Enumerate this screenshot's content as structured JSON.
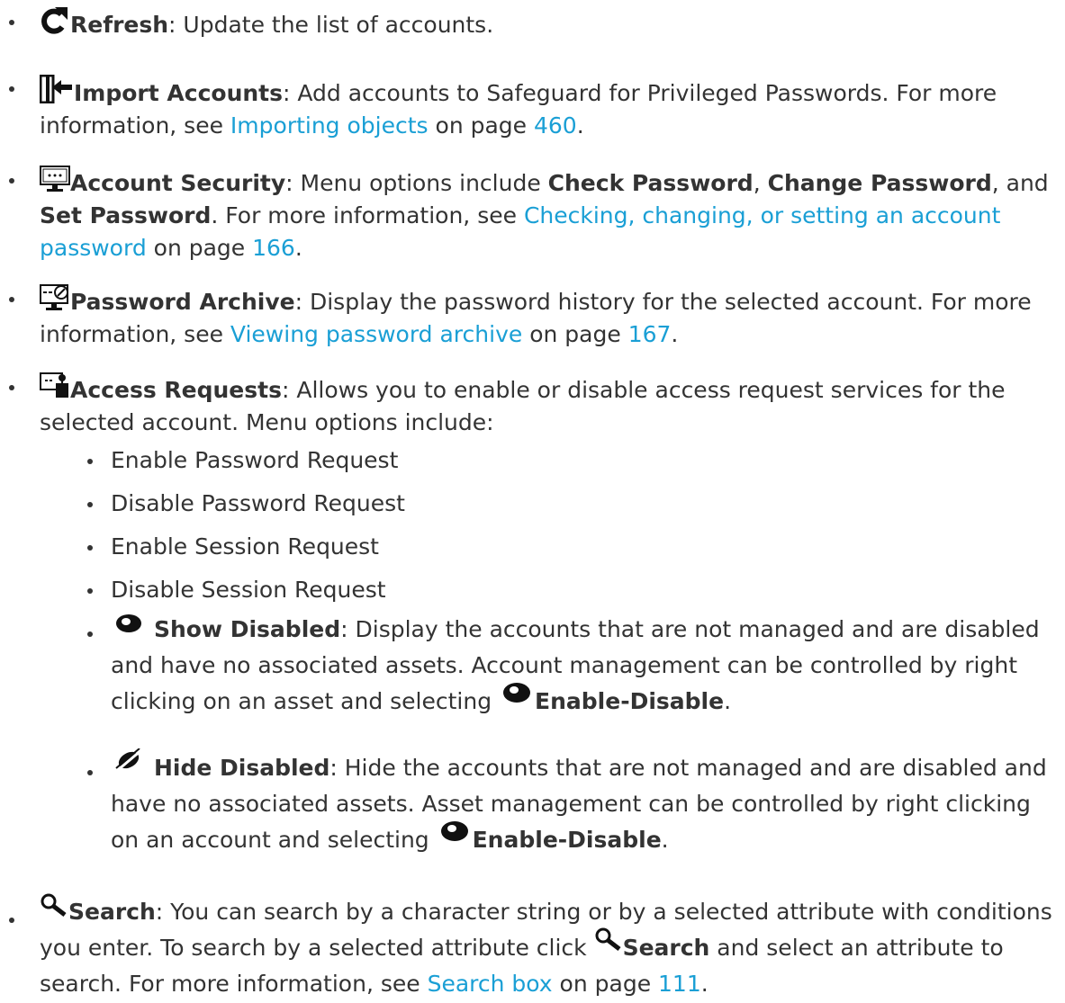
{
  "items": [
    {
      "icon": "refresh-icon",
      "title": "Refresh",
      "text": ": Update the list of accounts."
    },
    {
      "icon": "import-icon",
      "title": "Import Accounts",
      "text": ": Add accounts to Safeguard for Privileged Passwords. For more information, see ",
      "link": "Importing objects",
      "after": " on page ",
      "page": "460",
      "end": "."
    },
    {
      "icon": "account-security-icon",
      "title": "Account Security",
      "text1": ": Menu options include ",
      "opt1": "Check Password",
      "sep1": ", ",
      "opt2": "Change Password",
      "sep2": ", and ",
      "opt3": "Set Password",
      "text2": ". For more information, see ",
      "link": "Checking, changing, or setting an account password",
      "after": " on page ",
      "page": "166",
      "end": "."
    },
    {
      "icon": "password-archive-icon",
      "title": "Password Archive",
      "text": ": Display the password history for the selected account. For more information, see ",
      "link": "Viewing password archive",
      "after": " on page ",
      "page": "167",
      "end": "."
    },
    {
      "icon": "access-requests-icon",
      "title": "Access Requests",
      "text": ": Allows you to enable or disable access request services for the selected account. Menu options include:"
    }
  ],
  "subitems": [
    "Enable Password Request",
    "Disable Password Request",
    "Enable Session Request",
    "Disable Session Request"
  ],
  "show_disabled": {
    "icon": "eye-icon",
    "title": "Show Disabled",
    "text": ": Display the accounts that are not managed and are disabled and have no associated assets. Account management can be controlled by right clicking on an asset and selecting ",
    "action_icon": "eye-icon",
    "action": "Enable-Disable",
    "end": "."
  },
  "hide_disabled": {
    "icon": "eye-slash-icon",
    "title": "Hide Disabled",
    "text": ": Hide the accounts that are not managed and are disabled and have no associated assets. Asset management can be controlled by right clicking on an account and selecting ",
    "action_icon": "eye-icon",
    "action": "Enable-Disable",
    "end": "."
  },
  "search": {
    "icon": "search-icon",
    "title": "Search",
    "text1": ": You can search by a character string or by a selected attribute with conditions you enter. To search by a selected attribute click ",
    "inline_icon": "search-icon",
    "inline_title": "Search",
    "text2": " and select an attribute to search. For more information, see ",
    "link": "Search box",
    "after": " on page ",
    "page": "111",
    "end": "."
  }
}
